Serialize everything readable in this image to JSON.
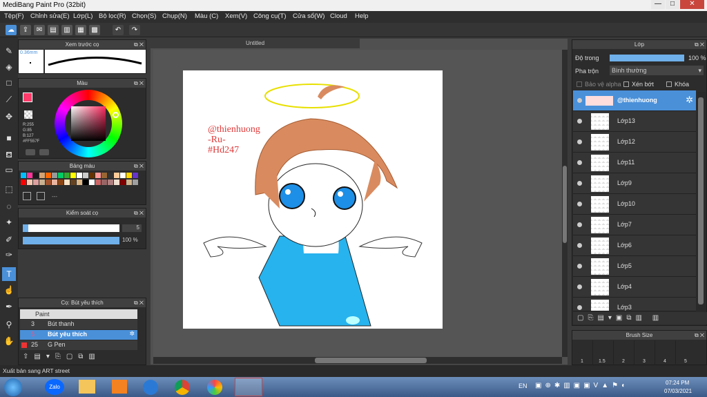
{
  "window": {
    "title": "MediBang Paint Pro (32bit)",
    "min": "—",
    "max": "□",
    "close": "✕"
  },
  "menu": [
    "Tệp(F)",
    "Chỉnh sửa(E)",
    "Lớp(L)",
    "Bộ lọc(R)",
    "Chọn(S)",
    "Chụp(N)",
    "Màu (C)",
    "Xem(V)",
    "Công cụ(T)",
    "Cửa sổ(W)",
    "Cloud",
    "Help"
  ],
  "brush_preview": {
    "title": "Xem trước cọ",
    "size": "0.36mm"
  },
  "color": {
    "title": "Màu",
    "r": "R:255",
    "g": "G:85",
    "b": "B:127",
    "hex": "#FF557F",
    "primary": "#FF3B6B"
  },
  "palette": {
    "title": "Bảng màu",
    "extra": "---",
    "colors": [
      "#00bfff",
      "#ff3399",
      "#1a1a1a",
      "#d4a373",
      "#ff6600",
      "#999999",
      "#00cc66",
      "#33aa33",
      "#ffff00",
      "#ffffff",
      "#cccccc",
      "#663300",
      "#ff9999",
      "#996633",
      "#333333",
      "#ffcc99",
      "#ffffff",
      "#ffd700",
      "#6633cc",
      "#ff0000",
      "#f5c6b0",
      "#dda0a0",
      "#c8b090",
      "#a0522d",
      "#e8b4a0",
      "#8b4513",
      "#ffe4c4",
      "#654321",
      "#deb887",
      "#000000",
      "#ffffff",
      "#cc6666",
      "#996666",
      "#b08080",
      "#f0e0d0",
      "#800000",
      "#d2b48c",
      "#a0a0a0"
    ]
  },
  "brush_control": {
    "title": "Kiểm soát cọ",
    "size": "5",
    "opacity": "100 %"
  },
  "brush_list": {
    "title": "Cọ: Bút yêu thích",
    "group": "Paint",
    "items": [
      {
        "num": "3",
        "name": "Bút thanh"
      },
      {
        "num": "5",
        "name": "Bút yêu thích"
      },
      {
        "num": "25",
        "name": "G Pen"
      }
    ]
  },
  "canvas": {
    "tab": "Untitled",
    "watermark": [
      "@thienhuong",
      "-Ru-",
      "#Hd247"
    ]
  },
  "layers_panel": {
    "title": "Lớp",
    "opacity_label": "Độ trong",
    "opacity_value": "100 %",
    "blend_label": "Pha trộn",
    "blend_value": "Bình thường",
    "protect_alpha": "Bảo vệ alpha",
    "clip": "Xén bớt",
    "lock": "Khóa",
    "layers": [
      "@thienhuong",
      "Lớp13",
      "Lớp12",
      "Lớp11",
      "Lớp9",
      "Lớp10",
      "Lớp7",
      "Lớp6",
      "Lớp5",
      "Lớp4",
      "Lớp3"
    ]
  },
  "brush_size": {
    "title": "Brush Size",
    "sizes": [
      "1",
      "1.5",
      "2",
      "3",
      "4",
      "5"
    ]
  },
  "status": "Xuất bản sang ART street",
  "taskbar": {
    "lang": "EN",
    "time": "07:24 PM",
    "date": "07/03/2021",
    "zalo": "Zalo"
  }
}
